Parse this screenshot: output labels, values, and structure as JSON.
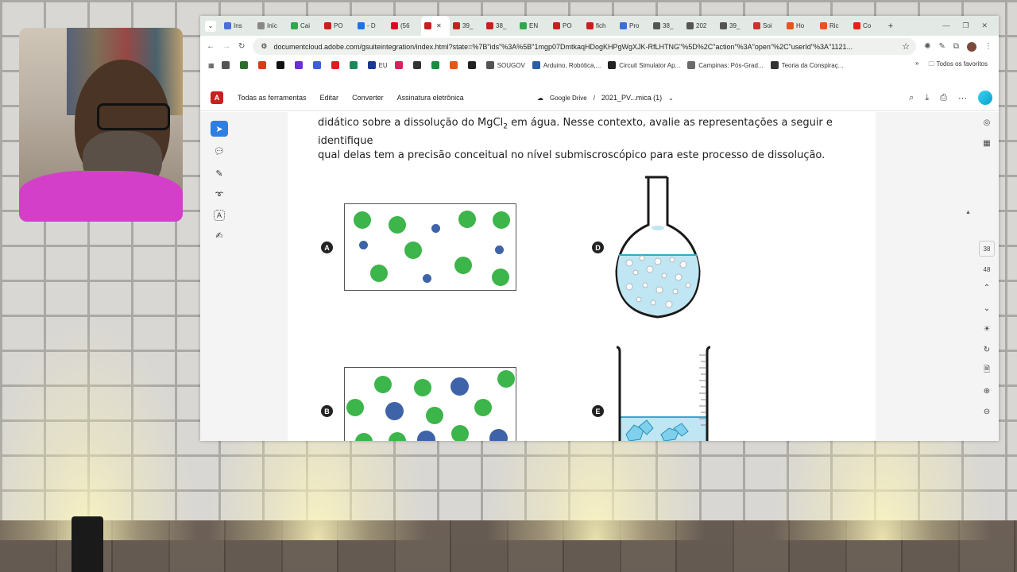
{
  "browser": {
    "tabs": [
      {
        "label": "Ins",
        "color": "#4a6fd8"
      },
      {
        "label": "Iníc",
        "color": "#888888"
      },
      {
        "label": "Cai",
        "color": "#2fa84f"
      },
      {
        "label": "PO",
        "color": "#c8201f"
      },
      {
        "label": "- D",
        "color": "#1a73e8"
      },
      {
        "label": "(56",
        "color": "#e60023"
      },
      {
        "label": "",
        "color": "#c8201f",
        "active": true
      },
      {
        "label": "39_",
        "color": "#c8201f"
      },
      {
        "label": "38_",
        "color": "#c8201f"
      },
      {
        "label": "EN",
        "color": "#2fa84f"
      },
      {
        "label": "PO",
        "color": "#c8201f"
      },
      {
        "label": "fich",
        "color": "#c8201f"
      },
      {
        "label": "Pro",
        "color": "#3a6fd8"
      },
      {
        "label": "38_",
        "color": "#555555"
      },
      {
        "label": "202",
        "color": "#555555"
      },
      {
        "label": "39_",
        "color": "#555555"
      },
      {
        "label": "Soi",
        "color": "#d32f2f"
      },
      {
        "label": "Ho",
        "color": "#e8541f"
      },
      {
        "label": "Ric",
        "color": "#e8541f"
      },
      {
        "label": "Co",
        "color": "#e62117"
      }
    ],
    "url": "documentcloud.adobe.com/gsuiteintegration/index.html?state=%7B\"ids\"%3A%5B\"1mgp07DmtkaqHDogKHPgWgXJK-RfLHTNG\"%5D%2C\"action\"%3A\"open\"%2C\"userId\"%3A\"1121...",
    "bookmarks": [
      {
        "label": "",
        "color": "#555555"
      },
      {
        "label": "",
        "color": "#2b6c2b"
      },
      {
        "label": "",
        "color": "#d83a1a"
      },
      {
        "label": "",
        "color": "#111111"
      },
      {
        "label": "",
        "color": "#6a2fd8"
      },
      {
        "label": "",
        "color": "#3a5fd8"
      },
      {
        "label": "",
        "color": "#d82020"
      },
      {
        "label": "",
        "color": "#1a8a5a"
      },
      {
        "label": "EU",
        "color": "#1a3a8a"
      },
      {
        "label": "",
        "color": "#d8205a"
      },
      {
        "label": "",
        "color": "#333333"
      },
      {
        "label": "",
        "color": "#1f8a3f"
      },
      {
        "label": "",
        "color": "#e8541f"
      },
      {
        "label": "",
        "color": "#222222"
      },
      {
        "label": "SOUGOV",
        "color": "#555555"
      },
      {
        "label": "Arduino, Robótica,...",
        "color": "#2a5fa8"
      },
      {
        "label": "Circuit Simulator Ap...",
        "color": "#222222"
      },
      {
        "label": "Campinas: Pós-Grad...",
        "color": "#6a6a6a"
      },
      {
        "label": "Teoria da Conspiraç...",
        "color": "#333333"
      }
    ],
    "all_favorites": "Todos os favoritos"
  },
  "acrobat": {
    "menu": [
      "Todas as ferramentas",
      "Editar",
      "Converter",
      "Assinatura eletrônica"
    ],
    "drive": "Google Drive",
    "sep": "/",
    "filename": "2021_PV...mica (1)",
    "page_current": "38",
    "page_next": "48"
  },
  "question": {
    "line1_a": "didático sobre a dissolução do MgCl",
    "line1_sub": "2",
    "line1_b": " em água. Nesse contexto, avalie as representações a seguir e identifique",
    "line2": "qual delas tem a precisão conceitual no nível submiscroscópico para este processo de dissolução."
  },
  "options": {
    "a": "A",
    "b": "B",
    "d": "D",
    "e": "E"
  },
  "colors": {
    "green": "#3cb54a",
    "blue": "#3e63a8",
    "accent": "#c8201f"
  }
}
